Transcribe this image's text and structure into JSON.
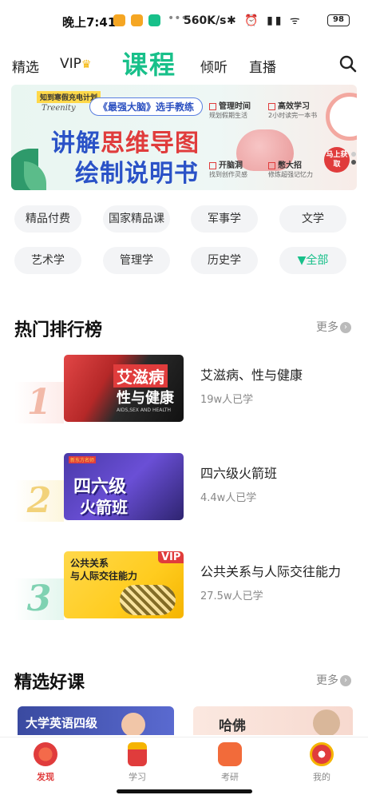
{
  "status": {
    "time": "晚上7:41",
    "speed": "560K/s",
    "icons": "✱ ⏰ ▮▮ ᯤ",
    "battery": "98",
    "app_colors": [
      "#f5a623",
      "#f5a623",
      "#18c08a"
    ]
  },
  "nav": {
    "items": [
      "精选",
      "VIP",
      "课程",
      "倾听",
      "直播"
    ],
    "active": "课程",
    "vip_icon": "crown-icon",
    "search_icon": "search-icon"
  },
  "banner": {
    "tag": "知到寒假充电计划",
    "brand": "Treenity",
    "subtitle": "《最强大脑》选手教练",
    "title_line1_a": "讲解",
    "title_line1_b": "思维导图",
    "title_line2": "绘制说明书",
    "features": [
      {
        "title": "管理时间",
        "desc": "规划假期生活"
      },
      {
        "title": "高效学习",
        "desc": "2小时读完一本书"
      },
      {
        "title": "开脑洞",
        "desc": "找到创作灵感"
      },
      {
        "title": "憋大招",
        "desc": "修炼超强记忆力"
      }
    ],
    "cta": "马上获取",
    "accent": "#2a52c7",
    "highlight": "#e03c3c"
  },
  "categories": [
    "精品付费",
    "国家精品课",
    "军事学",
    "文学",
    "艺术学",
    "管理学",
    "历史学",
    "全部"
  ],
  "hot": {
    "title": "热门排行榜",
    "more": "更多",
    "items": [
      {
        "rank": "1",
        "title": "艾滋病、性与健康",
        "count": "19w人已学",
        "thumb_line1": "艾滋病",
        "thumb_line2": "性与健康",
        "thumb_small": "AIDS,SEX AND HEALTH"
      },
      {
        "rank": "2",
        "title": "四六级火箭班",
        "count": "4.4w人已学",
        "thumb_line1": "四六级",
        "thumb_line2": "火箭班",
        "thumb_small": "新东方名师"
      },
      {
        "rank": "3",
        "title": "公共关系与人际交往能力",
        "count": "27.5w人已学",
        "thumb_line1": "公共关系",
        "thumb_line2": "与人际交往能力",
        "thumb_small": "VIP"
      }
    ]
  },
  "picks": {
    "title": "精选好课",
    "more": "更多",
    "cards": [
      {
        "label": "大学英语四级"
      },
      {
        "label": "哈佛"
      }
    ]
  },
  "tabs": [
    {
      "label": "发现",
      "active": true
    },
    {
      "label": "学习",
      "active": false
    },
    {
      "label": "考研",
      "active": false
    },
    {
      "label": "我的",
      "active": false
    }
  ],
  "colors": {
    "brand_green": "#18c08a",
    "tab_active": "#e03c3c"
  }
}
